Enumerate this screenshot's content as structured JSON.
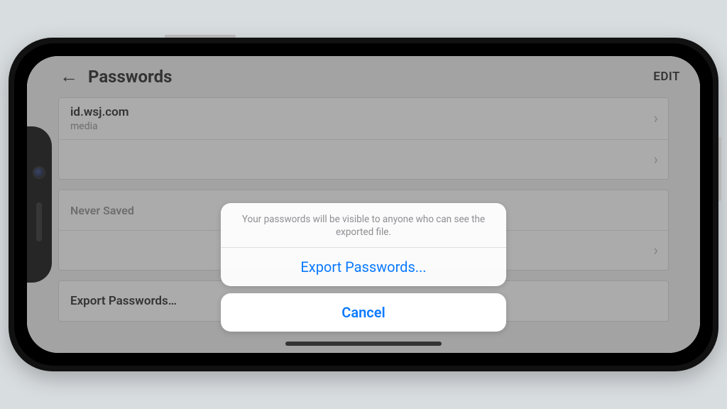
{
  "header": {
    "title": "Passwords",
    "edit": "EDIT"
  },
  "list": {
    "saved": [
      {
        "site": "id.wsj.com",
        "user": "media"
      },
      {
        "site": "",
        "user": ""
      }
    ],
    "never_saved_header": "Never Saved",
    "export_label": "Export Passwords…"
  },
  "sheet": {
    "message": "Your passwords will be visible to anyone who can see the exported file.",
    "export": "Export Passwords...",
    "cancel": "Cancel"
  }
}
